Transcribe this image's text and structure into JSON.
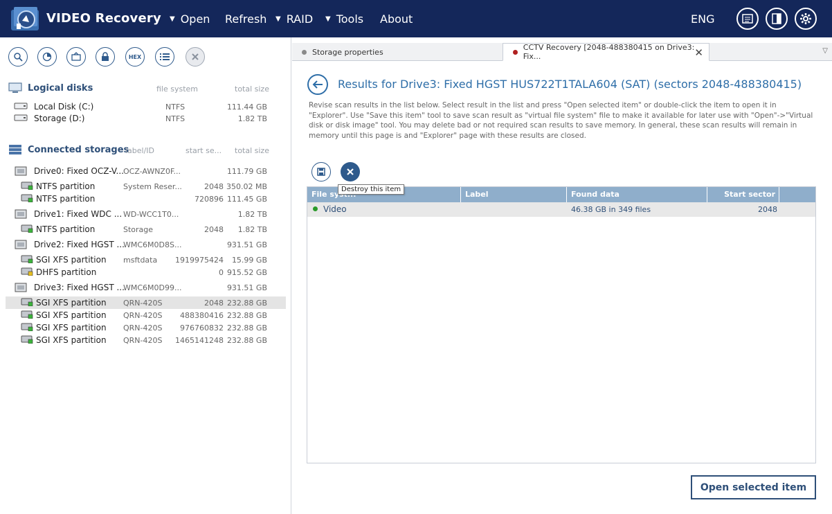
{
  "app": {
    "title": "VIDEO Recovery",
    "language": "ENG"
  },
  "menu": [
    {
      "label": "Open",
      "has_dropdown": true
    },
    {
      "label": "Refresh",
      "has_dropdown": false
    },
    {
      "label": "RAID",
      "has_dropdown": true
    },
    {
      "label": "Tools",
      "has_dropdown": true
    },
    {
      "label": "About",
      "has_dropdown": false
    }
  ],
  "toolbar": {
    "hex_label": "HEX"
  },
  "logical_disks": {
    "header": "Logical disks",
    "col_fs": "file system",
    "col_size": "total size",
    "items": [
      {
        "name": "Local Disk (C:)",
        "fs": "NTFS",
        "size": "111.44 GB"
      },
      {
        "name": "Storage (D:)",
        "fs": "NTFS",
        "size": "1.82 TB"
      }
    ]
  },
  "connected": {
    "header": "Connected storages",
    "col_label": "label/ID",
    "col_start": "start se...",
    "col_size": "total size",
    "items": [
      {
        "name": "Drive0: Fixed OCZ-V...",
        "label": "OCZ-AWNZ0F...",
        "start": "",
        "size": "111.79 GB",
        "kind": "drive"
      },
      {
        "name": "NTFS partition",
        "label": "System Reser...",
        "start": "2048",
        "size": "350.02 MB",
        "kind": "part-green"
      },
      {
        "name": "NTFS partition",
        "label": "",
        "start": "720896",
        "size": "111.45 GB",
        "kind": "part-green"
      },
      {
        "name": "Drive1: Fixed WDC ...",
        "label": "WD-WCC1T0...",
        "start": "",
        "size": "1.82 TB",
        "kind": "drive"
      },
      {
        "name": "NTFS partition",
        "label": "Storage",
        "start": "2048",
        "size": "1.82 TB",
        "kind": "part-green"
      },
      {
        "name": "Drive2: Fixed HGST ...",
        "label": "WMC6M0D8S...",
        "start": "",
        "size": "931.51 GB",
        "kind": "drive"
      },
      {
        "name": "SGI XFS partition",
        "label": "msftdata",
        "start": "1919975424",
        "size": "15.99 GB",
        "kind": "part-green"
      },
      {
        "name": "DHFS partition",
        "label": "",
        "start": "0",
        "size": "915.52 GB",
        "kind": "part-yellow"
      },
      {
        "name": "Drive3: Fixed HGST ...",
        "label": "WMC6M0D99...",
        "start": "",
        "size": "931.51 GB",
        "kind": "drive"
      },
      {
        "name": "SGI XFS partition",
        "label": "QRN-420S",
        "start": "2048",
        "size": "232.88 GB",
        "kind": "part-green",
        "selected": true
      },
      {
        "name": "SGI XFS partition",
        "label": "QRN-420S",
        "start": "488380416",
        "size": "232.88 GB",
        "kind": "part-green"
      },
      {
        "name": "SGI XFS partition",
        "label": "QRN-420S",
        "start": "976760832",
        "size": "232.88 GB",
        "kind": "part-green"
      },
      {
        "name": "SGI XFS partition",
        "label": "QRN-420S",
        "start": "1465141248",
        "size": "232.88 GB",
        "kind": "part-green"
      }
    ]
  },
  "tabs": [
    {
      "label": "Storage properties",
      "dot": "#8a8a8a",
      "active": false
    },
    {
      "label": "CCTV Recovery [2048-488380415 on Drive3: Fix...",
      "dot": "#b02020",
      "active": true
    }
  ],
  "results": {
    "title": "Results for Drive3: Fixed HGST HUS722T1TALA604 (SAT) (sectors 2048-488380415)",
    "description": "Revise scan results in the list below. Select result in the list and press \"Open selected item\" or double-click the item to open it in \"Explorer\". Use \"Save this item\" tool to save scan result as \"virtual file system\" file to make it available for later use with \"Open\"->\"Virtual disk or disk image\" tool. You may delete bad or not required scan results to save memory. In general, these scan results will remain in memory until this page is and \"Explorer\" page with these results are closed.",
    "tooltip": "Destroy this item",
    "columns": [
      "File syst...",
      "Label",
      "Found data",
      "Start sector"
    ],
    "rows": [
      {
        "fs": "Video",
        "label": "",
        "found": "46.38 GB in 349 files",
        "start": "2048",
        "status_color": "#2a9a2a"
      }
    ],
    "open_button": "Open selected item"
  },
  "colors": {
    "topbar": "#14275a",
    "accent": "#2e6ea8",
    "grid_header": "#8faecb"
  }
}
